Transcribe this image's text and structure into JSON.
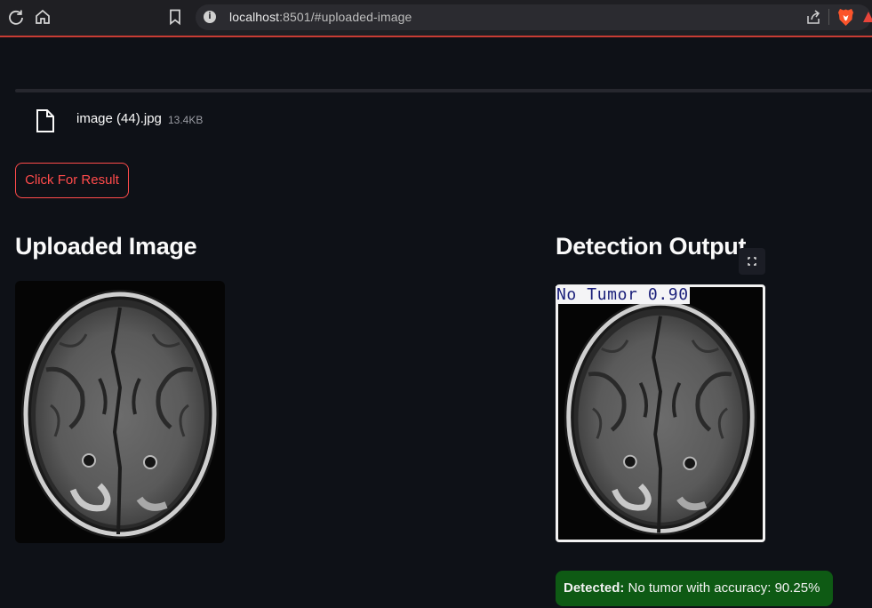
{
  "browser": {
    "url_host": "localhost",
    "url_rest": ":8501/#uploaded-image"
  },
  "uploader": {
    "file_name": "image (44).jpg",
    "file_size": "13.4KB"
  },
  "actions": {
    "result_button": "Click For Result"
  },
  "sections": {
    "uploaded_title": "Uploaded Image",
    "output_title": "Detection Output"
  },
  "detection": {
    "label": "No Tumor 0.90",
    "box_color": "#ffffff",
    "label_color": "#1a1f7a"
  },
  "result": {
    "prefix": "Detected:",
    "message": " No tumor with accuracy: 90.25%",
    "bg_color": "#0e5a14"
  },
  "icons": [
    "reload-icon",
    "home-icon",
    "bookmark-icon",
    "info-icon",
    "share-icon",
    "brave-icon",
    "warning-icon",
    "file-icon",
    "fullscreen-icon"
  ],
  "colors": {
    "background": "#0e1117",
    "accent": "#ff4b4b"
  }
}
